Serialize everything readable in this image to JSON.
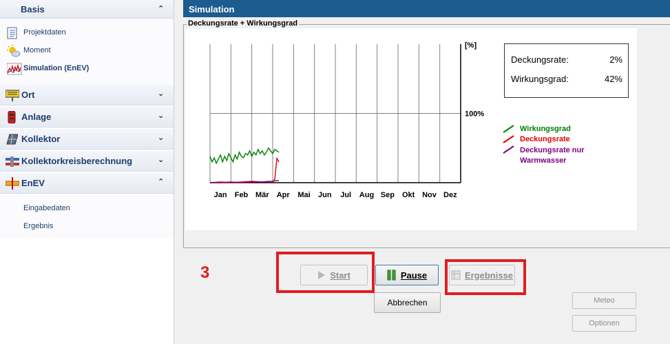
{
  "sidebar": {
    "basis": {
      "title": "Basis",
      "items": [
        {
          "label": "Projektdaten",
          "icon": "document-list-icon"
        },
        {
          "label": "Moment",
          "icon": "sun-cloud-icon"
        },
        {
          "label": "Simulation (EnEV)",
          "icon": "simulation-chart-icon"
        }
      ]
    },
    "sections": [
      {
        "label": "Ort",
        "icon": "location-sign-icon"
      },
      {
        "label": "Anlage",
        "icon": "boiler-icon"
      },
      {
        "label": "Kollektor",
        "icon": "solar-panel-icon"
      },
      {
        "label": "Kollektorkreisberechnung",
        "icon": "pipe-circuit-icon"
      },
      {
        "label": "EnEV",
        "icon": "enev-sign-icon"
      }
    ],
    "enev_items": [
      "Eingabedaten",
      "Ergebnis"
    ]
  },
  "main": {
    "title": "Simulation",
    "group_label": "Deckungsrate + Wirkungsgrad"
  },
  "info": {
    "deckungsrate_label": "Deckungsrate:",
    "deckungsrate_value": "2%",
    "wirkungsgrad_label": "Wirkungsgrad:",
    "wirkungsgrad_value": "42%"
  },
  "colors": {
    "wirkungsgrad": "#008000",
    "deckungsrate": "#e00000",
    "deckungsrate_ww": "#800080",
    "highlight": "#e11d22"
  },
  "chart_data": {
    "type": "line",
    "y_unit_label": "[%]",
    "y_tick_label": "100%",
    "categories": [
      "Jan",
      "Feb",
      "Mär",
      "Apr",
      "Mai",
      "Jun",
      "Jul",
      "Aug",
      "Sep",
      "Okt",
      "Nov",
      "Dez"
    ],
    "ylim": [
      0,
      200
    ],
    "grid": true,
    "legend_position": "right",
    "series": [
      {
        "name": "Wirkungsgrad",
        "color": "#008000",
        "x": [
          0.0,
          0.1,
          0.2,
          0.3,
          0.4,
          0.5,
          0.6,
          0.7,
          0.8,
          0.9,
          1.0,
          1.1,
          1.2,
          1.3,
          1.4,
          1.5,
          1.6,
          1.7,
          1.8,
          1.9,
          2.0,
          2.1,
          2.2,
          2.3,
          2.4,
          2.5,
          2.6,
          2.7,
          2.8,
          2.9,
          3.0,
          3.1,
          3.2,
          3.3
        ],
        "values": [
          38,
          30,
          36,
          28,
          34,
          40,
          30,
          38,
          32,
          42,
          36,
          30,
          40,
          34,
          44,
          38,
          36,
          42,
          40,
          46,
          38,
          44,
          40,
          48,
          42,
          46,
          40,
          44,
          50,
          46,
          42,
          48,
          46,
          44
        ]
      },
      {
        "name": "Deckungsrate",
        "color": "#e00000",
        "x": [
          0.0,
          0.5,
          1.0,
          1.5,
          2.0,
          2.5,
          2.8,
          3.0,
          3.1,
          3.15,
          3.2,
          3.3
        ],
        "values": [
          0,
          1,
          0,
          1,
          2,
          1,
          2,
          1,
          5,
          20,
          35,
          30
        ]
      },
      {
        "name": "Deckungsrate nur Warmwasser",
        "color": "#800080",
        "x": [
          0.0,
          0.5,
          1.0,
          1.5,
          2.0,
          2.5,
          3.0,
          3.2,
          3.3
        ],
        "values": [
          0,
          0,
          1,
          0,
          1,
          1,
          2,
          3,
          3
        ]
      }
    ]
  },
  "buttons": {
    "start": "Start",
    "pause": "Pause",
    "ergebnisse": "Ergebnisse",
    "abbrechen": "Abbrechen",
    "meteo": "Meteo",
    "optionen": "Optionen"
  },
  "annotation": {
    "step": "3"
  }
}
